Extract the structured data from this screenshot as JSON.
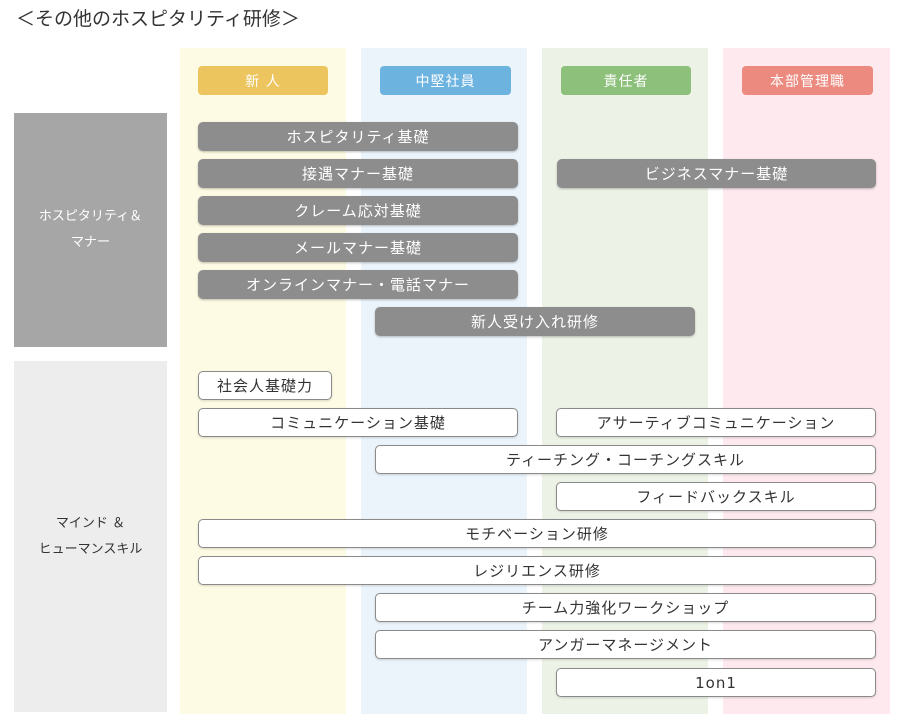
{
  "title": "＜その他のホスピタリティ研修＞",
  "columns": [
    {
      "label": "新 人",
      "bg": "#fdfbe3",
      "header_color": "#ecc55e"
    },
    {
      "label": "中堅社員",
      "bg": "#ebf4fb",
      "header_color": "#6cb3e0"
    },
    {
      "label": "責任者",
      "bg": "#ecf3e6",
      "header_color": "#8dc07a"
    },
    {
      "label": "本部管理職",
      "bg": "#fde9ee",
      "header_color": "#ec8a7f"
    }
  ],
  "rows": [
    {
      "label_lines": [
        "ホスピタリティ＆",
        "マナー"
      ],
      "bg": "#a6a6a6",
      "color": "#ffffff"
    },
    {
      "label_lines": [
        "マインド ＆",
        "ヒューマンスキル"
      ],
      "bg": "#ededed",
      "color": "#333333"
    }
  ],
  "trainings": {
    "hospitality_basics": "ホスピタリティ基礎",
    "reception_manners": "接遇マナー基礎",
    "business_manners": "ビジネスマナー基礎",
    "complaint_handling": "クレーム応対基礎",
    "email_manners": "メールマナー基礎",
    "online_phone_manners": "オンラインマナー・電話マナー",
    "newcomer_onboarding": "新人受け入れ研修",
    "working_basics": "社会人基礎力",
    "communication_basics": "コミュニケーション基礎",
    "assertive_communication": "アサーティブコミュニケーション",
    "teaching_coaching": "ティーチング・コーチングスキル",
    "feedback_skills": "フィードバックスキル",
    "motivation": "モチベーション研修",
    "resilience": "レジリエンス研修",
    "team_workshop": "チーム力強化ワークショップ",
    "anger_management": "アンガーマネージメント",
    "one_on_one": "1on1"
  }
}
